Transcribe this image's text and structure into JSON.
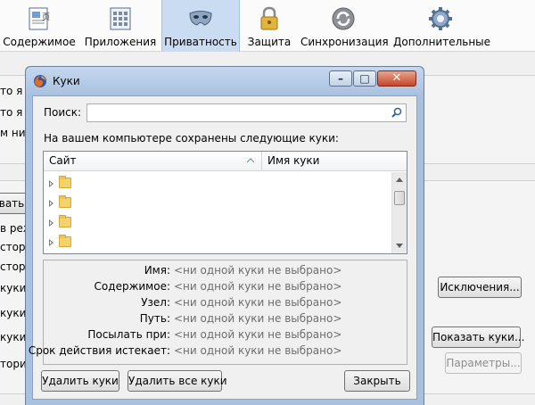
{
  "toolbar": {
    "items": [
      {
        "label": "Содержимое",
        "icon": "content-icon",
        "selected": false
      },
      {
        "label": "Приложения",
        "icon": "applications-icon",
        "selected": false
      },
      {
        "label": "Приватность",
        "icon": "privacy-mask-icon",
        "selected": true
      },
      {
        "label": "Защита",
        "icon": "security-lock-icon",
        "selected": false
      },
      {
        "label": "Синхронизация",
        "icon": "sync-icon",
        "selected": false
      },
      {
        "label": "Дополнительные",
        "icon": "advanced-gear-icon",
        "selected": false
      }
    ]
  },
  "background_pane": {
    "fragments": [
      "то я с",
      "то я з",
      "м нич",
      "вать",
      "в реж",
      "стори",
      "стори",
      "куки",
      "куки",
      "куки:",
      "торин"
    ],
    "buttons": {
      "exceptions": "Исключения...",
      "show_cookies": "Показать куки...",
      "settings": "Параметры..."
    }
  },
  "dialog": {
    "title": "Куки",
    "search": {
      "label": "Поиск:",
      "value": "",
      "placeholder": ""
    },
    "description": "На вашем компьютере сохранены следующие куки:",
    "tree": {
      "columns": [
        "Сайт",
        "Имя куки"
      ],
      "row_count_visible": 4
    },
    "details": [
      {
        "label": "Имя:",
        "value": "<ни одной куки не выбрано>"
      },
      {
        "label": "Содержимое:",
        "value": "<ни одной куки не выбрано>"
      },
      {
        "label": "Узел:",
        "value": "<ни одной куки не выбрано>"
      },
      {
        "label": "Путь:",
        "value": "<ни одной куки не выбрано>"
      },
      {
        "label": "Посылать при:",
        "value": "<ни одной куки не выбрано>"
      },
      {
        "label": "Срок действия истекает:",
        "value": "<ни одной куки не выбрано>"
      }
    ],
    "buttons": {
      "remove": "Удалить куки",
      "remove_all": "Удалить все куки",
      "close": "Закрыть"
    }
  },
  "colors": {
    "selected_tab": "#c9dcf2",
    "dialog_frame": "#a9c1e0",
    "close_button": "#c7452a"
  }
}
